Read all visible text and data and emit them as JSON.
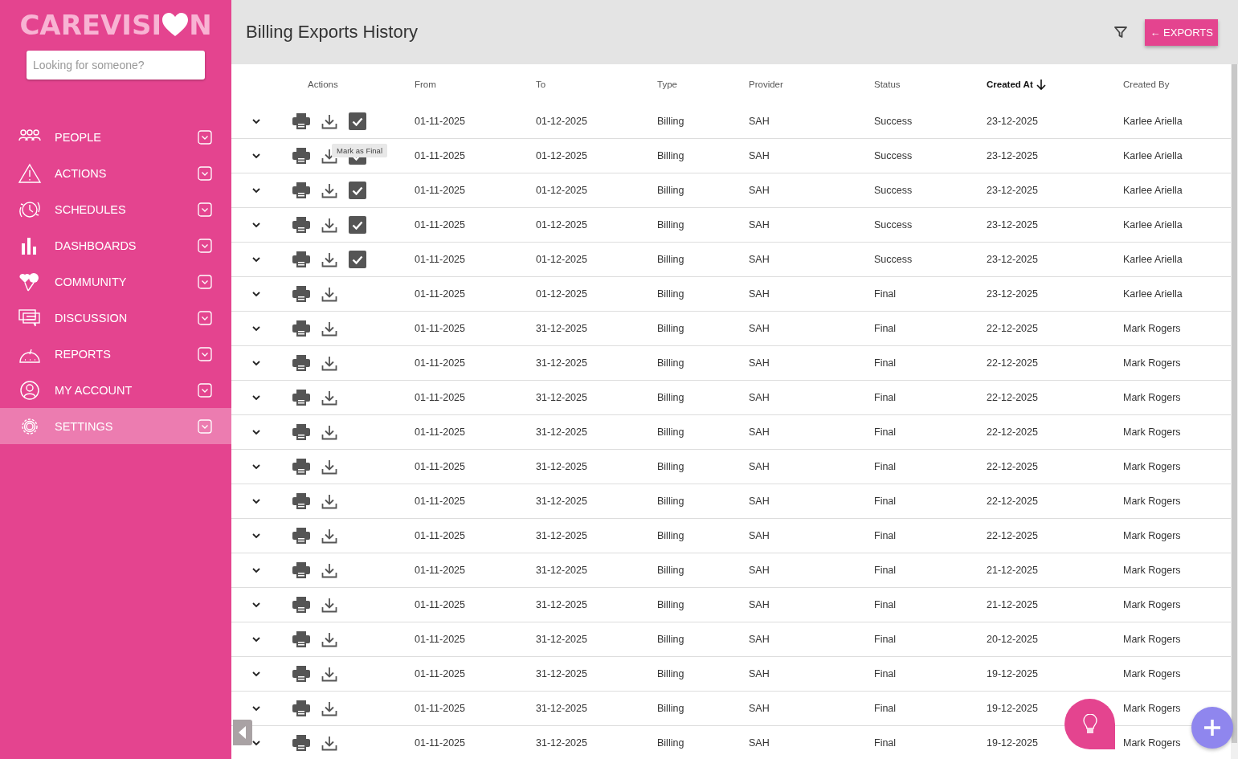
{
  "sidebar": {
    "logo": {
      "before": "CAREVISI",
      "after": "N"
    },
    "search": {
      "placeholder": "Looking for someone?"
    },
    "items": [
      {
        "label": "PEOPLE",
        "selected": false
      },
      {
        "label": "ACTIONS",
        "selected": false
      },
      {
        "label": "SCHEDULES",
        "selected": false
      },
      {
        "label": "DASHBOARDS",
        "selected": false
      },
      {
        "label": "COMMUNITY",
        "selected": false
      },
      {
        "label": "DISCUSSION",
        "selected": false
      },
      {
        "label": "REPORTS",
        "selected": false
      },
      {
        "label": "MY ACCOUNT",
        "selected": false
      },
      {
        "label": "SETTINGS",
        "selected": true
      }
    ]
  },
  "header": {
    "title": "Billing Exports History",
    "button": "← EXPORTS"
  },
  "table": {
    "columns": [
      {
        "label": "Actions",
        "sorted": false
      },
      {
        "label": "From",
        "sorted": false
      },
      {
        "label": "To",
        "sorted": false
      },
      {
        "label": "Type",
        "sorted": false
      },
      {
        "label": "Provider",
        "sorted": false
      },
      {
        "label": "Status",
        "sorted": false
      },
      {
        "label": "Created At",
        "sorted": true
      },
      {
        "label": "Created By",
        "sorted": false
      }
    ],
    "rows": [
      {
        "from": "01-11-2025",
        "to": "01-12-2025",
        "type": "Billing",
        "provider": "SAH",
        "status": "Success",
        "created_at": "23-12-2025",
        "created_by": "Karlee Ariella",
        "final_checkbox": {
          "checked": true
        }
      },
      {
        "from": "01-11-2025",
        "to": "01-12-2025",
        "type": "Billing",
        "provider": "SAH",
        "status": "Success",
        "created_at": "23-12-2025",
        "created_by": "Karlee Ariella",
        "final_checkbox": {
          "checked": true
        },
        "tooltip": "Mark as Final"
      },
      {
        "from": "01-11-2025",
        "to": "01-12-2025",
        "type": "Billing",
        "provider": "SAH",
        "status": "Success",
        "created_at": "23-12-2025",
        "created_by": "Karlee Ariella",
        "final_checkbox": {
          "checked": true
        }
      },
      {
        "from": "01-11-2025",
        "to": "01-12-2025",
        "type": "Billing",
        "provider": "SAH",
        "status": "Success",
        "created_at": "23-12-2025",
        "created_by": "Karlee Ariella",
        "final_checkbox": {
          "checked": true
        }
      },
      {
        "from": "01-11-2025",
        "to": "01-12-2025",
        "type": "Billing",
        "provider": "SAH",
        "status": "Success",
        "created_at": "23-12-2025",
        "created_by": "Karlee Ariella",
        "final_checkbox": {
          "checked": true
        }
      },
      {
        "from": "01-11-2025",
        "to": "01-12-2025",
        "type": "Billing",
        "provider": "SAH",
        "status": "Final",
        "created_at": "23-12-2025",
        "created_by": "Karlee Ariella"
      },
      {
        "from": "01-11-2025",
        "to": "31-12-2025",
        "type": "Billing",
        "provider": "SAH",
        "status": "Final",
        "created_at": "22-12-2025",
        "created_by": "Mark Rogers"
      },
      {
        "from": "01-11-2025",
        "to": "31-12-2025",
        "type": "Billing",
        "provider": "SAH",
        "status": "Final",
        "created_at": "22-12-2025",
        "created_by": "Mark Rogers"
      },
      {
        "from": "01-11-2025",
        "to": "31-12-2025",
        "type": "Billing",
        "provider": "SAH",
        "status": "Final",
        "created_at": "22-12-2025",
        "created_by": "Mark Rogers"
      },
      {
        "from": "01-11-2025",
        "to": "31-12-2025",
        "type": "Billing",
        "provider": "SAH",
        "status": "Final",
        "created_at": "22-12-2025",
        "created_by": "Mark Rogers"
      },
      {
        "from": "01-11-2025",
        "to": "31-12-2025",
        "type": "Billing",
        "provider": "SAH",
        "status": "Final",
        "created_at": "22-12-2025",
        "created_by": "Mark Rogers"
      },
      {
        "from": "01-11-2025",
        "to": "31-12-2025",
        "type": "Billing",
        "provider": "SAH",
        "status": "Final",
        "created_at": "22-12-2025",
        "created_by": "Mark Rogers"
      },
      {
        "from": "01-11-2025",
        "to": "31-12-2025",
        "type": "Billing",
        "provider": "SAH",
        "status": "Final",
        "created_at": "22-12-2025",
        "created_by": "Mark Rogers"
      },
      {
        "from": "01-11-2025",
        "to": "31-12-2025",
        "type": "Billing",
        "provider": "SAH",
        "status": "Final",
        "created_at": "21-12-2025",
        "created_by": "Mark Rogers"
      },
      {
        "from": "01-11-2025",
        "to": "31-12-2025",
        "type": "Billing",
        "provider": "SAH",
        "status": "Final",
        "created_at": "21-12-2025",
        "created_by": "Mark Rogers"
      },
      {
        "from": "01-11-2025",
        "to": "31-12-2025",
        "type": "Billing",
        "provider": "SAH",
        "status": "Final",
        "created_at": "20-12-2025",
        "created_by": "Mark Rogers"
      },
      {
        "from": "01-11-2025",
        "to": "31-12-2025",
        "type": "Billing",
        "provider": "SAH",
        "status": "Final",
        "created_at": "19-12-2025",
        "created_by": "Mark Rogers"
      },
      {
        "from": "01-11-2025",
        "to": "31-12-2025",
        "type": "Billing",
        "provider": "SAH",
        "status": "Final",
        "created_at": "19-12-2025",
        "created_by": "Mark Rogers"
      },
      {
        "from": "01-11-2025",
        "to": "31-12-2025",
        "type": "Billing",
        "provider": "SAH",
        "status": "Final",
        "created_at": "19-12-2025",
        "created_by": "Mark Rogers"
      }
    ]
  }
}
